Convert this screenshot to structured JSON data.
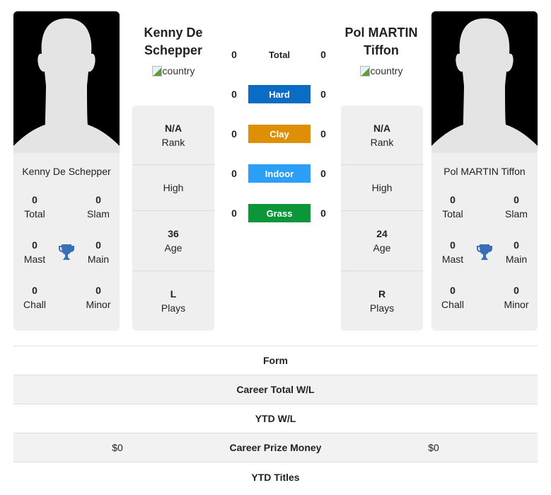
{
  "players": [
    {
      "name": "Kenny De Schepper",
      "header_name_line1": "Kenny De",
      "header_name_line2": "Schepper",
      "country_alt": "country",
      "rank": {
        "value": "N/A",
        "label": "Rank"
      },
      "high": {
        "value": "",
        "label": "High"
      },
      "age": {
        "value": "36",
        "label": "Age"
      },
      "plays": {
        "value": "L",
        "label": "Plays"
      },
      "titles": {
        "total": {
          "value": "0",
          "label": "Total"
        },
        "slam": {
          "value": "0",
          "label": "Slam"
        },
        "mast": {
          "value": "0",
          "label": "Mast"
        },
        "main": {
          "value": "0",
          "label": "Main"
        },
        "chall": {
          "value": "0",
          "label": "Chall"
        },
        "minor": {
          "value": "0",
          "label": "Minor"
        }
      }
    },
    {
      "name": "Pol MARTIN Tiffon",
      "header_name_line1": "Pol MARTIN",
      "header_name_line2": "Tiffon",
      "country_alt": "country",
      "rank": {
        "value": "N/A",
        "label": "Rank"
      },
      "high": {
        "value": "",
        "label": "High"
      },
      "age": {
        "value": "24",
        "label": "Age"
      },
      "plays": {
        "value": "R",
        "label": "Plays"
      },
      "titles": {
        "total": {
          "value": "0",
          "label": "Total"
        },
        "slam": {
          "value": "0",
          "label": "Slam"
        },
        "mast": {
          "value": "0",
          "label": "Mast"
        },
        "main": {
          "value": "0",
          "label": "Main"
        },
        "chall": {
          "value": "0",
          "label": "Chall"
        },
        "minor": {
          "value": "0",
          "label": "Minor"
        }
      }
    }
  ],
  "h2h": {
    "total": {
      "label": "Total",
      "left": "0",
      "right": "0"
    },
    "surfaces": [
      {
        "label": "Hard",
        "left": "0",
        "right": "0",
        "color": "#0a6cc2"
      },
      {
        "label": "Clay",
        "left": "0",
        "right": "0",
        "color": "#de8f06"
      },
      {
        "label": "Indoor",
        "left": "0",
        "right": "0",
        "color": "#2b9ff6"
      },
      {
        "label": "Grass",
        "left": "0",
        "right": "0",
        "color": "#0b9639"
      }
    ]
  },
  "stats": [
    {
      "label": "Form",
      "left": "",
      "right": ""
    },
    {
      "label": "Career Total W/L",
      "left": "",
      "right": ""
    },
    {
      "label": "YTD W/L",
      "left": "",
      "right": ""
    },
    {
      "label": "Career Prize Money",
      "left": "$0",
      "right": "$0"
    },
    {
      "label": "YTD Titles",
      "left": "",
      "right": ""
    }
  ],
  "icons": {
    "trophy": "trophy-icon",
    "silhouette": "player-silhouette"
  },
  "colors": {
    "trophy": "#3a6fb5",
    "card_bg": "#efefef"
  }
}
